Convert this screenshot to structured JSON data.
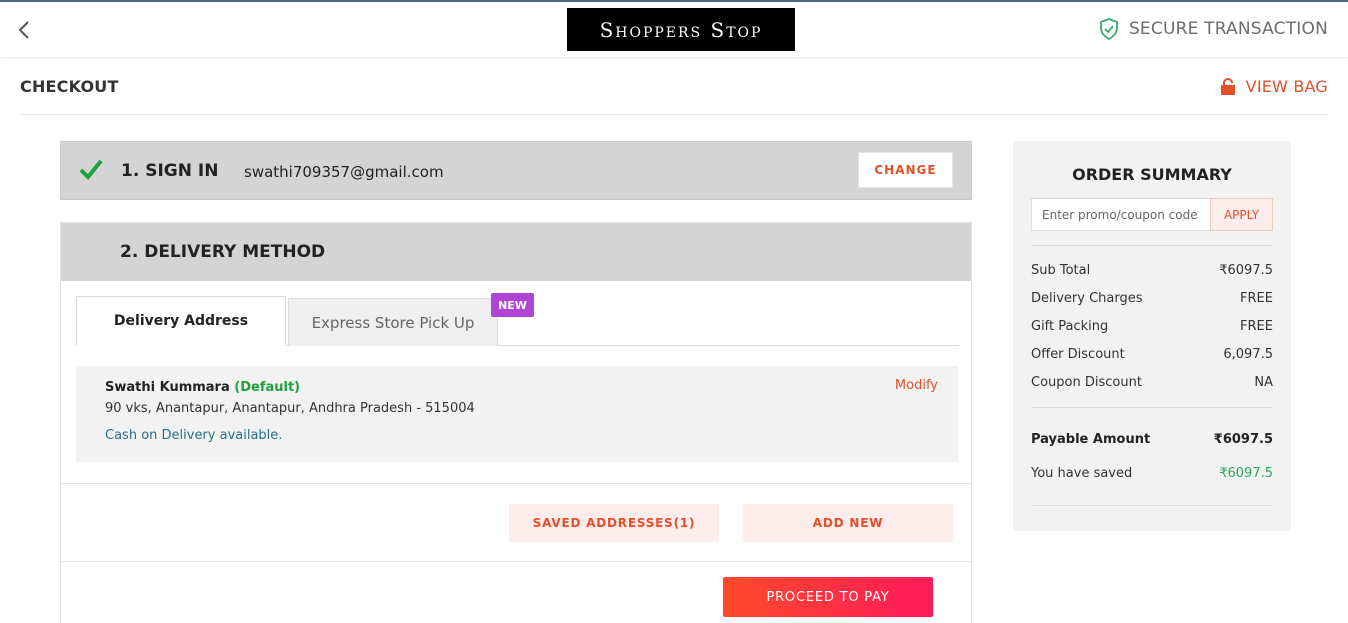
{
  "header": {
    "logo_text": "Shoppers Stop",
    "secure_label": "SECURE TRANSACTION",
    "back_icon": "chevron-left-icon",
    "secure_icon": "shield-check-icon"
  },
  "checkout_bar": {
    "title": "CHECKOUT",
    "view_bag_label": "VIEW BAG",
    "bag_icon": "bag-icon"
  },
  "sign_in": {
    "title": "1. SIGN IN",
    "email": "swathi709357@gmail.com",
    "change_label": "CHANGE"
  },
  "delivery": {
    "title": "2. DELIVERY METHOD",
    "tabs": [
      {
        "label": "Delivery Address",
        "active": true
      },
      {
        "label": "Express Store Pick Up",
        "active": false
      }
    ],
    "new_badge": "NEW",
    "address": {
      "name": "Swathi Kummara",
      "default_label": "(Default)",
      "line": "90 vks, Anantapur, Anantapur, Andhra Pradesh - 515004",
      "cod_note": "Cash on Delivery available.",
      "modify_label": "Modify"
    },
    "saved_addresses_label": "SAVED ADDRESSES(1)",
    "add_new_label": "ADD NEW",
    "proceed_label": "PROCEED TO PAY"
  },
  "summary": {
    "title": "ORDER SUMMARY",
    "promo_placeholder": "Enter promo/coupon code",
    "apply_label": "APPLY",
    "rows": [
      {
        "label": "Sub Total",
        "value": "₹6097.5"
      },
      {
        "label": "Delivery Charges",
        "value": "FREE"
      },
      {
        "label": "Gift Packing",
        "value": "FREE"
      },
      {
        "label": "Offer Discount",
        "value": "6,097.5"
      },
      {
        "label": "Coupon Discount",
        "value": "NA"
      }
    ],
    "payable_label": "Payable Amount",
    "payable_value": "₹6097.5",
    "saved_label": "You have saved",
    "saved_value": "₹6097.5"
  },
  "colors": {
    "accent": "#e3502a",
    "success": "#1ea23d",
    "badge": "#b144d3",
    "section_header": "#d4d4d4"
  }
}
